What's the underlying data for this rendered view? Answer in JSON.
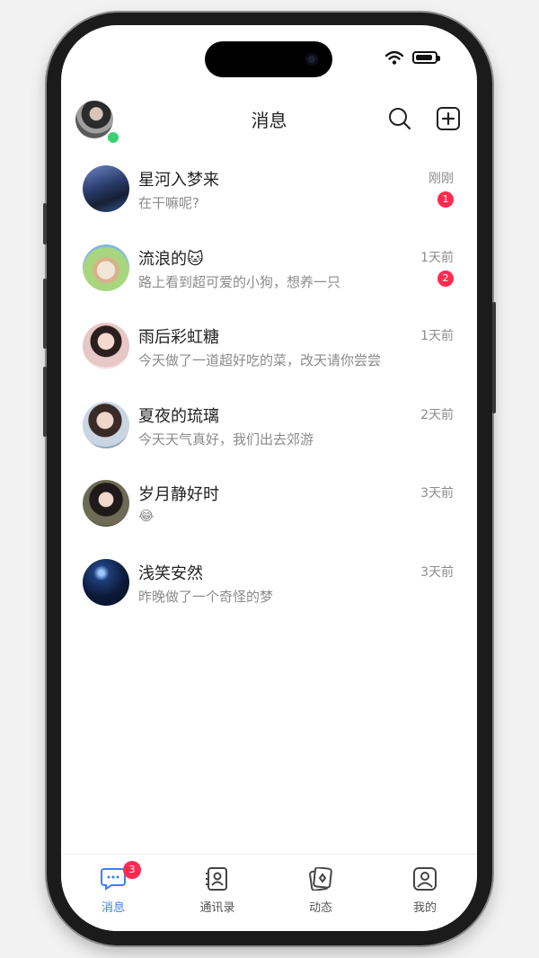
{
  "header": {
    "title": "消息"
  },
  "conversations": [
    {
      "name": "星河入梦来",
      "preview": "在干嘛呢?",
      "time": "刚刚",
      "unread": "1"
    },
    {
      "name": "流浪的🐱",
      "preview": "路上看到超可爱的小狗，想养一只",
      "time": "1天前",
      "unread": "2"
    },
    {
      "name": "雨后彩虹糖",
      "preview": "今天做了一道超好吃的菜，改天请你尝尝",
      "time": "1天前",
      "unread": ""
    },
    {
      "name": "夏夜的琉璃",
      "preview": "今天天气真好，我们出去郊游",
      "time": "2天前",
      "unread": ""
    },
    {
      "name": "岁月静好时",
      "preview": "😂",
      "time": "3天前",
      "unread": ""
    },
    {
      "name": "浅笑安然",
      "preview": "昨晚做了一个奇怪的梦",
      "time": "3天前",
      "unread": ""
    }
  ],
  "tabbar": {
    "messages": {
      "label": "消息",
      "badge": "3"
    },
    "contacts": {
      "label": "通讯录"
    },
    "moments": {
      "label": "动态"
    },
    "me": {
      "label": "我的"
    }
  },
  "colors": {
    "accent": "#3d7dff",
    "badge": "#ff2b4f",
    "online": "#3ccf6e"
  },
  "icons": [
    "search-icon",
    "add-icon",
    "wifi-icon",
    "battery-icon",
    "chat-icon",
    "contacts-icon",
    "moments-icon",
    "profile-icon"
  ]
}
